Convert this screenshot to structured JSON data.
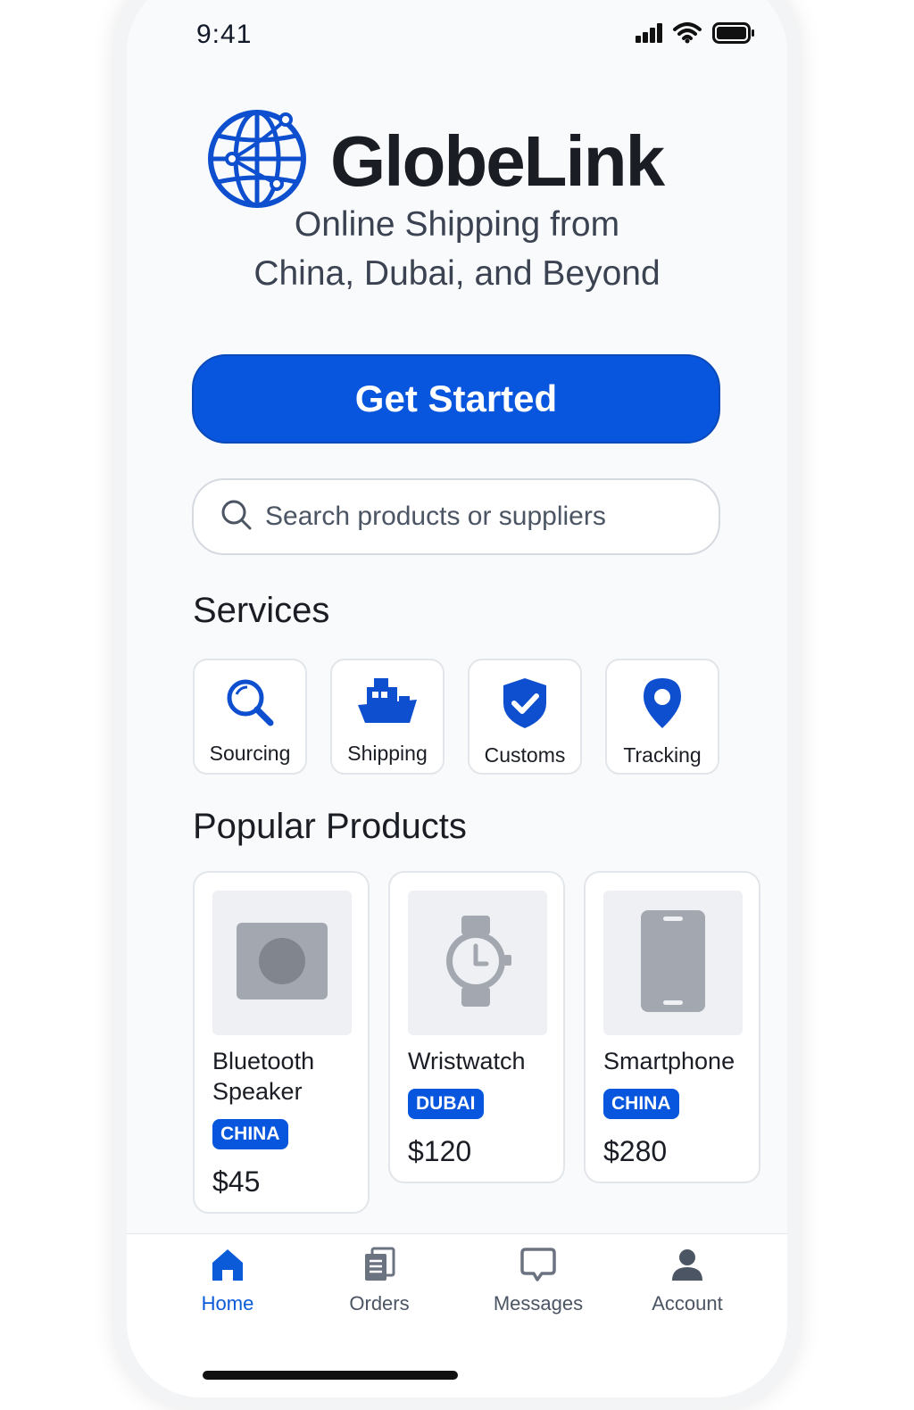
{
  "status_bar": {
    "time": "9:41"
  },
  "brand": {
    "name": "GlobeLink",
    "tagline_lines": [
      "Online Shipping from",
      "China, Dubai, and Beyond"
    ]
  },
  "cta": {
    "label": "Get Started"
  },
  "search": {
    "placeholder": "Search products or suppliers"
  },
  "services": {
    "title": "Services",
    "items": [
      {
        "label": "Sourcing",
        "icon": "magnifier-icon"
      },
      {
        "label": "Shipping",
        "icon": "ship-icon"
      },
      {
        "label": "Customs",
        "icon": "shield-check-icon"
      },
      {
        "label": "Tracking",
        "icon": "location-pin-icon"
      }
    ]
  },
  "products": {
    "title": "Popular Products",
    "items": [
      {
        "name": "Bluetooth Speaker",
        "origin": "CHINA",
        "price": "$45",
        "icon": "speaker-icon"
      },
      {
        "name": "Wristwatch",
        "origin": "DUBAI",
        "price": "$120",
        "icon": "watch-icon"
      },
      {
        "name": "Smartphone",
        "origin": "CHINA",
        "price": "$280",
        "icon": "phone-icon"
      }
    ]
  },
  "tabbar": {
    "items": [
      {
        "label": "Home",
        "active": true,
        "icon": "home-icon"
      },
      {
        "label": "Orders",
        "active": false,
        "icon": "orders-icon"
      },
      {
        "label": "Messages",
        "active": false,
        "icon": "messages-icon"
      },
      {
        "label": "Account",
        "active": false,
        "icon": "account-icon"
      }
    ]
  },
  "colors": {
    "accent": "#0756dd",
    "text": "#1a1d24",
    "muted": "#4b5563",
    "placeholder_gray": "#9ca3af"
  }
}
